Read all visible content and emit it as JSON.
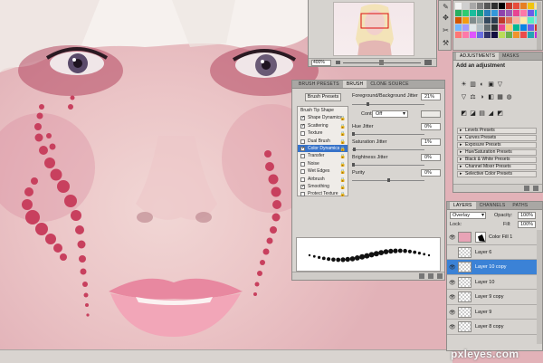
{
  "canvas": {
    "zoom": "",
    "photo_icon": "face-photo"
  },
  "navigator": {
    "zoom_value": "400%"
  },
  "tools": [
    "brush-icon",
    "move-icon",
    "cut-icon",
    "wrench-icon"
  ],
  "swatches": {
    "colors": [
      "#f2f2f2",
      "#cfcfcf",
      "#a8a8a8",
      "#7e7e7e",
      "#565656",
      "#2f2f2f",
      "#000000",
      "#c0392b",
      "#e74c3c",
      "#e67e22",
      "#f1c40f",
      "#f9e79f",
      "#27ae60",
      "#2ecc71",
      "#1abc9c",
      "#16a085",
      "#2980b9",
      "#3498db",
      "#8e44ad",
      "#9b59b6",
      "#e84393",
      "#fd79a8",
      "#6c5ce7",
      "#00cec9",
      "#d35400",
      "#f39c12",
      "#7f8c8d",
      "#95a5a6",
      "#34495e",
      "#2c3e50",
      "#c0392b",
      "#e17055",
      "#fab1a0",
      "#ffeaa7",
      "#55efc4",
      "#81ecec",
      "#74b9ff",
      "#a29bfe",
      "#dfe6e9",
      "#b2bec3",
      "#636e72",
      "#2d3436",
      "#e84393",
      "#fdcb6e",
      "#00b894",
      "#0984e3",
      "#6c5ce7",
      "#d63031",
      "#ff7675",
      "#fd79a8",
      "#e056fd",
      "#686de0",
      "#30336b",
      "#130f40",
      "#badc58",
      "#6ab04c",
      "#f0932b",
      "#eb4d4b",
      "#22a6b3",
      "#be2edd"
    ]
  },
  "adjustments": {
    "tabs": [
      "ADJUSTMENTS",
      "MASKS"
    ],
    "title": "Add an adjustment",
    "icons_row1": [
      "☀",
      "▥",
      "◐",
      "▣",
      "▽"
    ],
    "icons_row2": [
      "▽",
      "⚖",
      "◑",
      "◧",
      "▦",
      "◍"
    ],
    "icons_row3": [
      "◩",
      "◪",
      "▤",
      "◢",
      "◩"
    ],
    "presets": [
      "Levels Presets",
      "Curves Presets",
      "Exposure Presets",
      "Hue/Saturation Presets",
      "Black & White Presets",
      "Channel Mixer Presets",
      "Selective Color Presets"
    ]
  },
  "brush": {
    "tabs": [
      "BRUSH PRESETS",
      "BRUSH",
      "CLONE SOURCE"
    ],
    "presets_button": "Brush Presets",
    "list": [
      {
        "label": "Brush Tip Shape",
        "header": true
      },
      {
        "label": "Shape Dynamics",
        "checked": true
      },
      {
        "label": "Scattering",
        "checked": true
      },
      {
        "label": "Texture",
        "checked": false
      },
      {
        "label": "Dual Brush",
        "checked": false
      },
      {
        "label": "Color Dynamics",
        "checked": true,
        "selected": true
      },
      {
        "label": "Transfer",
        "checked": false
      },
      {
        "label": "Noise",
        "checked": false
      },
      {
        "label": "Wet Edges",
        "checked": false
      },
      {
        "label": "Airbrush",
        "checked": false
      },
      {
        "label": "Smoothing",
        "checked": true
      },
      {
        "label": "Protect Texture",
        "checked": false
      }
    ],
    "fg_bg_jitter_label": "Foreground/Background Jitter",
    "fg_bg_jitter_value": "21%",
    "control_label": "Control:",
    "control_value": "Off",
    "hue_jitter_label": "Hue Jitter",
    "hue_jitter_value": "0%",
    "saturation_jitter_label": "Saturation Jitter",
    "saturation_jitter_value": "1%",
    "brightness_jitter_label": "Brightness Jitter",
    "brightness_jitter_value": "0%",
    "purity_label": "Purity",
    "purity_value": "0%",
    "fg_bg_jitter_level": 0.21,
    "saturation_jitter_level": 0.01,
    "purity_level": 0.5
  },
  "layers": {
    "tabs": [
      "LAYERS",
      "CHANNELS",
      "PATHS"
    ],
    "blend_mode": "Overlay",
    "opacity_label": "Opacity:",
    "opacity_value": "100%",
    "lock_label": "Lock:",
    "fill_label": "Fill:",
    "fill_value": "100%",
    "items": [
      {
        "name": "Color Fill 1",
        "visible": true,
        "type": "fill"
      },
      {
        "name": "Layer 6",
        "visible": false,
        "type": "layer"
      },
      {
        "name": "Layer 10 copy",
        "visible": true,
        "type": "layer",
        "selected": true
      },
      {
        "name": "Layer 10",
        "visible": true,
        "type": "layer"
      },
      {
        "name": "Layer 9 copy",
        "visible": true,
        "type": "layer"
      },
      {
        "name": "Layer 9",
        "visible": true,
        "type": "layer"
      },
      {
        "name": "Layer 8 copy",
        "visible": true,
        "type": "layer"
      }
    ]
  },
  "watermark": "pxleyes.com"
}
